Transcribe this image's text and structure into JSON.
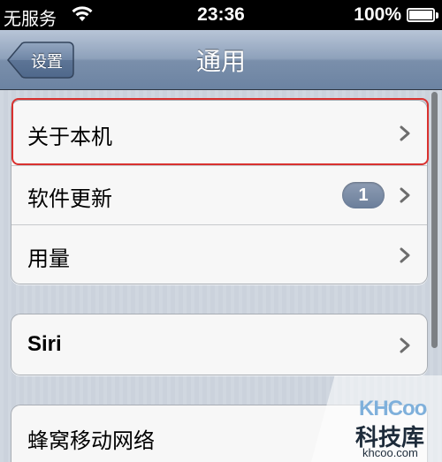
{
  "status_bar": {
    "carrier": "无服务",
    "time": "23:36",
    "battery": "100%",
    "battery_level": 1.0
  },
  "nav": {
    "back_label": "设置",
    "title": "通用"
  },
  "groups": [
    {
      "items": [
        {
          "label": "关于本机"
        },
        {
          "label": "软件更新",
          "badge": "1"
        },
        {
          "label": "用量"
        }
      ]
    },
    {
      "items": [
        {
          "label": "Siri"
        }
      ]
    },
    {
      "items": [
        {
          "label": "蜂窝移动网络"
        }
      ]
    }
  ],
  "watermark": {
    "logo": "KHCoo",
    "title": "科技库",
    "url": "khcoo.com"
  },
  "colors": {
    "highlight": "#d9312f",
    "badge": "#7a8ba5",
    "nav_bar": "#8ea1bb"
  }
}
